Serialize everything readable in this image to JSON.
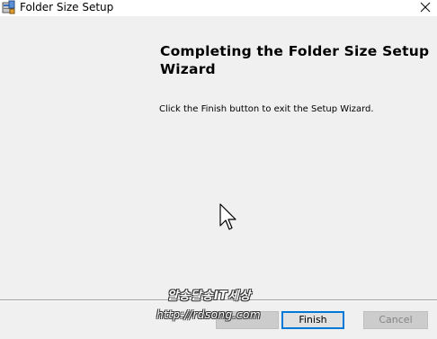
{
  "window": {
    "title": "Folder Size Setup",
    "app_icon": "installer-icon",
    "close_icon": "close-icon"
  },
  "content": {
    "heading": "Completing the Folder Size Setup Wizard",
    "description": "Click the Finish button to exit the Setup Wizard."
  },
  "buttons": {
    "back_label": "",
    "finish_label": "Finish",
    "cancel_label": "Cancel"
  },
  "watermark": {
    "line1": "알송달송IT세상",
    "line2": "http://rdsong.com"
  },
  "colors": {
    "window_bg": "#f0f0f0",
    "titlebar_bg": "#ffffff",
    "focus_border": "#0078d7",
    "disabled_text": "#838383"
  }
}
